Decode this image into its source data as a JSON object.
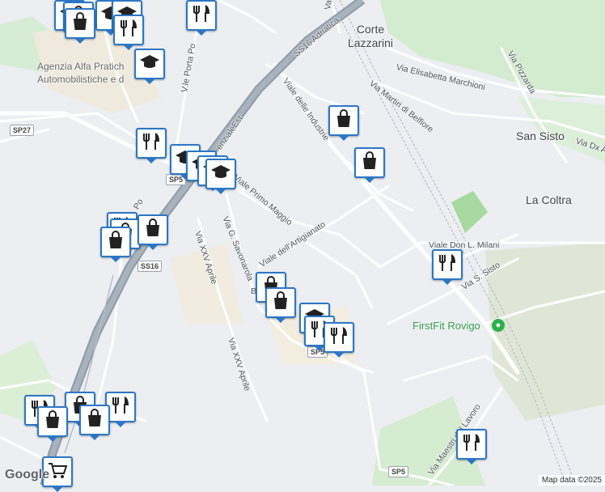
{
  "places": {
    "corte_lazzarini": [
      "Corte",
      "Lazzarini"
    ],
    "san_sisto": "San Sisto",
    "la_coltra": "La Coltra",
    "agenzia": [
      "Agenzia Alfa Pratich",
      "Automobilistiche e d"
    ]
  },
  "roads": {
    "ss16_adriatica": "SS16 Adriatica",
    "viale_industrie": "Viale delle Industrie",
    "via_elisabetta": "Via Elisabetta Marchioni",
    "via_martiri": "Via Martiri di Belfiore",
    "via_pizzarda": "Via Pizzarda",
    "via_dx": "Via Dx A",
    "viale_porta_po": "V.le Porta Po",
    "tangenziale": "enzialeEst",
    "viale_primo_maggio": "Viale Primo Maggio",
    "via_savonarola": "Via G. Savonarola",
    "via_xxv_aprile_1": "Via XXV Aprile",
    "via_xxv_aprile_2": "Via XXV Aprile",
    "viale_artigianato": "Viale dell'Artigianato",
    "viale_don_milani": "Viale Don L. Milani",
    "via_s_sisto": "Via S. Sisto",
    "via_maestri_lavoro": "Via Maestri del Lavoro",
    "po_fragment": "Po",
    "b_fragment": "B",
    "va_fragment": "Va"
  },
  "shields": {
    "sp27": "SP27",
    "sp5_a": "SP5",
    "ss16": "SS16",
    "sp5_b": "SP5",
    "sp5_c": "SP5",
    "ss16_top": "SS16"
  },
  "poi": {
    "firstfit": "FirstFit Rovigo"
  },
  "icons": {
    "shopping": "shopping-bag-icon",
    "restaurant": "fork-knife-icon",
    "school": "graduation-cap-icon",
    "grocery": "shopping-cart-icon",
    "gym": "dumbbell-icon"
  },
  "colors": {
    "pin_border": "#2b77c6",
    "park": "#c9e8c6",
    "park_dark": "#a7d9a0",
    "motorway": "#8e9aa8",
    "land": "#eceef2"
  },
  "logo": "Google",
  "attribution": "Map data ©2025"
}
